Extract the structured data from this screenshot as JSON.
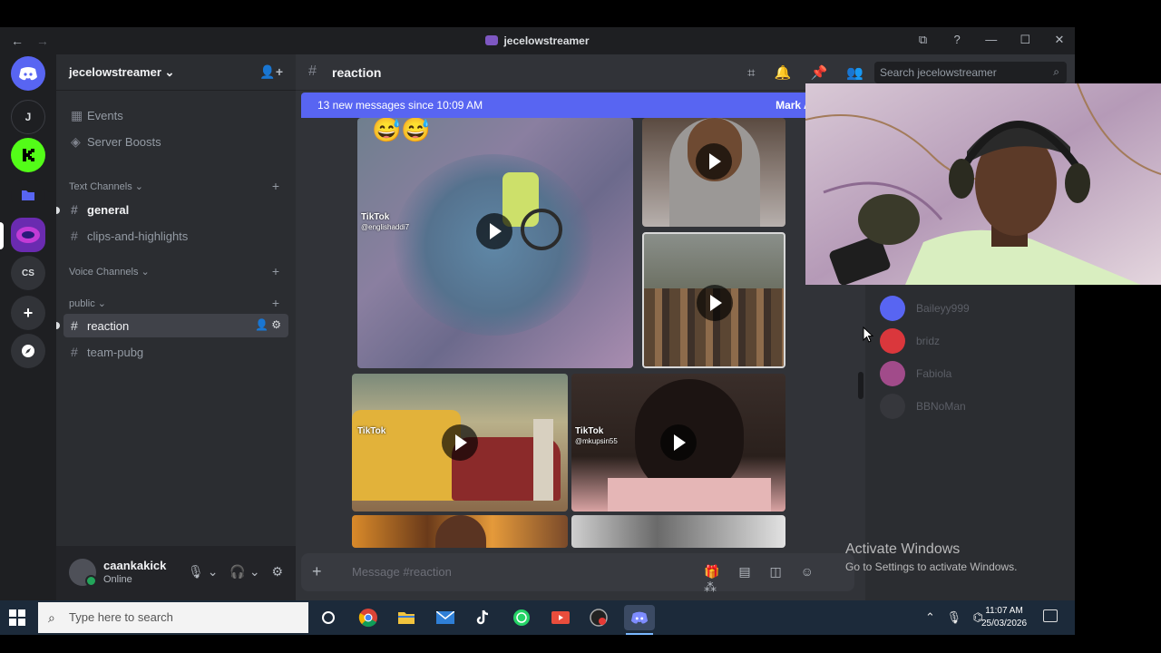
{
  "window": {
    "title": "jecelowstreamer",
    "nav_back": "←",
    "nav_forward": "→",
    "controls": [
      "⧉",
      "?",
      "—",
      "☐",
      "✕"
    ]
  },
  "server_rail": {
    "items": [
      "J",
      "CS",
      "+"
    ]
  },
  "sidebar": {
    "server_name": "jecelowstreamer",
    "events_label": "Events",
    "boosts_label": "Server Boosts",
    "categories": {
      "text": "Text Channels",
      "voice": "Voice Channels",
      "public": "public"
    },
    "channels": {
      "general": "general",
      "clips": "clips-and-highlights",
      "reaction": "reaction",
      "team_pubg": "team-pubg"
    }
  },
  "user_panel": {
    "username": "caankakick",
    "status": "Online"
  },
  "chat": {
    "channel_name": "reaction",
    "search_placeholder": "Search jecelowstreamer",
    "new_messages": "13 new messages since 10:09 AM",
    "mark_read": "Mark As Re...",
    "composer_placeholder": "Message #reaction",
    "tiktok_label": "TikTok",
    "tiktok_handles": [
      "@englishaddi7",
      "@mkupsin55"
    ],
    "emoji": "😅😅"
  },
  "members": {
    "names": [
      "Baileyy999",
      "bridz",
      "Fabiola",
      "BBNoMan"
    ]
  },
  "activate": {
    "title": "Activate Windows",
    "subtitle": "Go to Settings to activate Windows."
  },
  "taskbar": {
    "search_placeholder": "Type here to search",
    "time": "11:07 AM",
    "date": "25/03/2026"
  },
  "colors": {
    "blurple": "#5865f2",
    "sidebar": "#2b2d31",
    "chat": "#313338",
    "online": "#23a55a"
  }
}
